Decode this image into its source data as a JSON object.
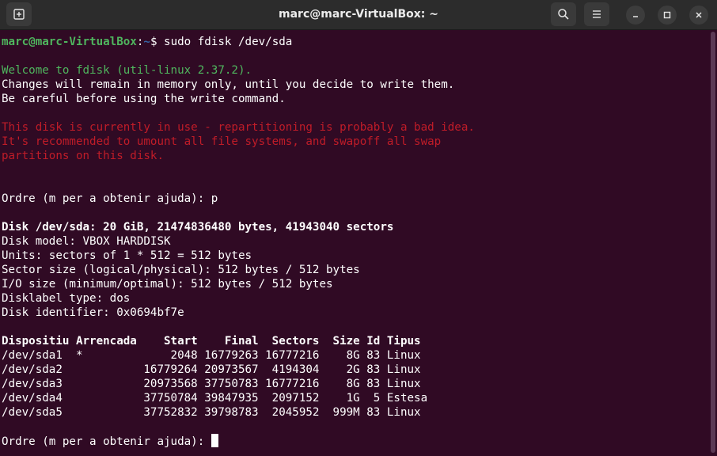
{
  "window": {
    "title": "marc@marc-VirtualBox: ~"
  },
  "terminal": {
    "prompt_user": "marc@marc-VirtualBox",
    "prompt_sep": ":",
    "prompt_path": "~",
    "prompt_end": "$ ",
    "command": "sudo fdisk /dev/sda",
    "welcome": "Welcome to fdisk (util-linux 2.37.2).",
    "info1": "Changes will remain in memory only, until you decide to write them.",
    "info2": "Be careful before using the write command.",
    "warn1": "This disk is currently in use - repartitioning is probably a bad idea.",
    "warn2": "It's recommended to umount all file systems, and swapoff all swap",
    "warn3": "partitions on this disk.",
    "order_prompt1": "Ordre (m per a obtenir ajuda): p",
    "disk_line": "Disk /dev/sda: 20 GiB, 21474836480 bytes, 41943040 sectors",
    "disk_model": "Disk model: VBOX HARDDISK",
    "units": "Units: sectors of 1 * 512 = 512 bytes",
    "sector_size": "Sector size (logical/physical): 512 bytes / 512 bytes",
    "io_size": "I/O size (minimum/optimal): 512 bytes / 512 bytes",
    "disklabel": "Disklabel type: dos",
    "identifier": "Disk identifier: 0x0694bf7e",
    "table_header": "Dispositiu Arrencada    Start    Final  Sectors  Size Id Tipus",
    "rows": [
      "/dev/sda1  *             2048 16779263 16777216    8G 83 Linux",
      "/dev/sda2            16779264 20973567  4194304    2G 83 Linux",
      "/dev/sda3            20973568 37750783 16777216    8G 83 Linux",
      "/dev/sda4            37750784 39847935  2097152    1G  5 Estesa",
      "/dev/sda5            37752832 39798783  2045952  999M 83 Linux"
    ],
    "order_prompt2": "Ordre (m per a obtenir ajuda): "
  }
}
